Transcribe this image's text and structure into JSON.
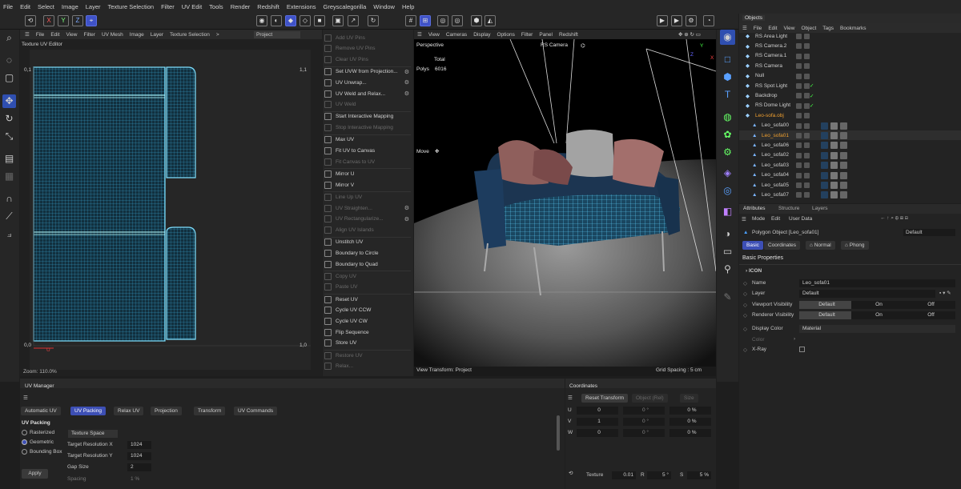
{
  "menubar": [
    "File",
    "Edit",
    "Select",
    "Image",
    "Layer",
    "Texture Selection",
    "Filter",
    "UV Edit",
    "Tools",
    "Render",
    "Redshift",
    "Extensions",
    "Greyscalegorilla",
    "Window",
    "Help"
  ],
  "toolbar": {
    "axes": [
      "X",
      "Y",
      "Z"
    ]
  },
  "uv_editor": {
    "menu": [
      "File",
      "Edit",
      "View",
      "Filter",
      "UV Mesh",
      "Image",
      "Layer",
      "Texture Selection",
      ">"
    ],
    "project_dropdown": "Project",
    "title": "Texture UV Editor",
    "corner_tl": "0,1",
    "corner_tr": "1,1",
    "corner_bl": "0,0",
    "corner_br": "1,0",
    "u_label": "U",
    "zoom": "Zoom: 110.0%"
  },
  "uv_commands": [
    {
      "label": "Add UV Pins",
      "enabled": false,
      "gear": false
    },
    {
      "label": "Remove UV Pins",
      "enabled": false,
      "gear": false
    },
    {
      "label": "Clear UV Pins",
      "enabled": false,
      "gear": false
    },
    {
      "label": "Set UVW from Projection...",
      "enabled": true,
      "gear": true
    },
    {
      "label": "UV Unwrap...",
      "enabled": true,
      "gear": true
    },
    {
      "label": "UV Weld and Relax...",
      "enabled": true,
      "gear": true
    },
    {
      "label": "UV Weld",
      "enabled": false,
      "gear": false
    },
    {
      "label": "Start Interactive Mapping",
      "enabled": true,
      "gear": false
    },
    {
      "label": "Stop Interactive Mapping",
      "enabled": false,
      "gear": false
    },
    {
      "label": "Max UV",
      "enabled": true,
      "gear": false
    },
    {
      "label": "Fit UV to Canvas",
      "enabled": true,
      "gear": false
    },
    {
      "label": "Fit Canvas to UV",
      "enabled": false,
      "gear": false
    },
    {
      "label": "Mirror U",
      "enabled": true,
      "gear": false
    },
    {
      "label": "Mirror V",
      "enabled": true,
      "gear": false
    },
    {
      "label": "Line Up UV",
      "enabled": false,
      "gear": false
    },
    {
      "label": "UV Straighten...",
      "enabled": false,
      "gear": true
    },
    {
      "label": "UV Rectangularize...",
      "enabled": false,
      "gear": true
    },
    {
      "label": "Align UV Islands",
      "enabled": false,
      "gear": false
    },
    {
      "label": "Unstitch UV",
      "enabled": true,
      "gear": false
    },
    {
      "label": "Boundary to Circle",
      "enabled": true,
      "gear": false
    },
    {
      "label": "Boundary to Quad",
      "enabled": true,
      "gear": false
    },
    {
      "label": "Copy UV",
      "enabled": false,
      "gear": false
    },
    {
      "label": "Paste UV",
      "enabled": false,
      "gear": false
    },
    {
      "label": "Reset UV",
      "enabled": true,
      "gear": false
    },
    {
      "label": "Cycle UV CCW",
      "enabled": true,
      "gear": false
    },
    {
      "label": "Cycle UV CW",
      "enabled": true,
      "gear": false
    },
    {
      "label": "Flip Sequence",
      "enabled": true,
      "gear": false
    },
    {
      "label": "Store UV",
      "enabled": true,
      "gear": false
    },
    {
      "label": "Restore UV",
      "enabled": false,
      "gear": false
    },
    {
      "label": "Relax...",
      "enabled": false,
      "gear": false
    }
  ],
  "viewport": {
    "menu": [
      "View",
      "Cameras",
      "Display",
      "Options",
      "Filter",
      "Panel",
      "Redshift"
    ],
    "view_name": "Perspective",
    "camera": "RS Camera",
    "total_label": "Total",
    "polys_label": "Polys",
    "polys_value": "6016",
    "move_label": "Move",
    "transform": "View Transform: Project",
    "grid": "Grid Spacing : 5 cm",
    "axis_labels": [
      "Y",
      "Z",
      "X"
    ]
  },
  "objects": {
    "tab": "Objects",
    "menu": [
      "File",
      "Edit",
      "View",
      "Object",
      "Tags",
      "Bookmarks"
    ],
    "rows": [
      {
        "name": "RS Area Light",
        "indent": 0,
        "selected": false,
        "check": false
      },
      {
        "name": "RS Camera.2",
        "indent": 0,
        "selected": false,
        "check": false
      },
      {
        "name": "RS Camera.1",
        "indent": 0,
        "selected": false,
        "check": false
      },
      {
        "name": "RS Camera",
        "indent": 0,
        "selected": false,
        "check": false
      },
      {
        "name": "Null",
        "indent": 0,
        "selected": false,
        "check": false
      },
      {
        "name": "RS Spot Light",
        "indent": 0,
        "selected": false,
        "check": true
      },
      {
        "name": "Backdrop",
        "indent": 0,
        "selected": false,
        "check": true
      },
      {
        "name": "RS Dome Light",
        "indent": 0,
        "selected": false,
        "check": true
      },
      {
        "name": "Leo-sofa.obj",
        "indent": 0,
        "selected": true,
        "check": false
      },
      {
        "name": "Leo_sofa00",
        "indent": 1,
        "selected": false,
        "check": false
      },
      {
        "name": "Leo_sofa01",
        "indent": 1,
        "selected": true,
        "check": false
      },
      {
        "name": "Leo_sofa06",
        "indent": 1,
        "selected": false,
        "check": false
      },
      {
        "name": "Leo_sofa02",
        "indent": 1,
        "selected": false,
        "check": false
      },
      {
        "name": "Leo_sofa03",
        "indent": 1,
        "selected": false,
        "check": false
      },
      {
        "name": "Leo_sofa04",
        "indent": 1,
        "selected": false,
        "check": false
      },
      {
        "name": "Leo_sofa05",
        "indent": 1,
        "selected": false,
        "check": false
      },
      {
        "name": "Leo_sofa07",
        "indent": 1,
        "selected": false,
        "check": false
      }
    ]
  },
  "attributes": {
    "tabs": [
      "Attributes",
      "Structure",
      "Layers"
    ],
    "menu": [
      "Mode",
      "Edit",
      "User Data"
    ],
    "object_title": "Polygon Object [Leo_sofa01]",
    "preset": "Default",
    "subtabs": [
      "Basic",
      "Coordinates",
      "Normal",
      "Phong"
    ],
    "section": "Basic Properties",
    "icon_label": "ICON",
    "name_label": "Name",
    "name_value": "Leo_sofa01",
    "layer_label": "Layer",
    "layer_value": "Default",
    "viewport_vis_label": "Viewport Visibility",
    "renderer_vis_label": "Renderer Visibility",
    "vis_options": [
      "Default",
      "On",
      "Off"
    ],
    "display_color_label": "Display Color",
    "display_color_value": "Material",
    "color_label": "Color",
    "xray_label": "X-Ray"
  },
  "uv_manager": {
    "title": "UV Manager",
    "tabs": [
      "Automatic UV",
      "UV Packing",
      "Relax UV",
      "Projection",
      "Transform",
      "UV Commands"
    ],
    "section": "UV Packing",
    "modes": [
      "Rasterized",
      "Geometric",
      "Bounding Box"
    ],
    "selected_mode": "Geometric",
    "space_dropdown": "Texture Space",
    "res_x_label": "Target Resolution X",
    "res_x": "1024",
    "res_y_label": "Target Resolution Y",
    "res_y": "1024",
    "gap_label": "Gap Size",
    "gap": "2",
    "spacing_label": "Spacing",
    "spacing": "1 %",
    "apply": "Apply"
  },
  "coordinates": {
    "title": "Coordinates",
    "reset": "Reset Transform",
    "object_rel": "Object (Rel)",
    "size_label": "Size",
    "rows": [
      {
        "axis": "U",
        "pos": "0",
        "rot": "0 °",
        "scale": "0 %"
      },
      {
        "axis": "V",
        "pos": "1",
        "rot": "0 °",
        "scale": "0 %"
      },
      {
        "axis": "W",
        "pos": "0",
        "rot": "0 °",
        "scale": "0 %"
      }
    ],
    "texture_label": "Texture",
    "texture_value": "0.01",
    "r_label": "R",
    "r_value": "5 °",
    "s_label": "S",
    "s_value": "5 %"
  },
  "colors": {
    "accent": "#3d4fb5",
    "uv_grid": "#4fc3e8",
    "sofa": "#1f3a57",
    "pillow": "#a36f6c"
  }
}
